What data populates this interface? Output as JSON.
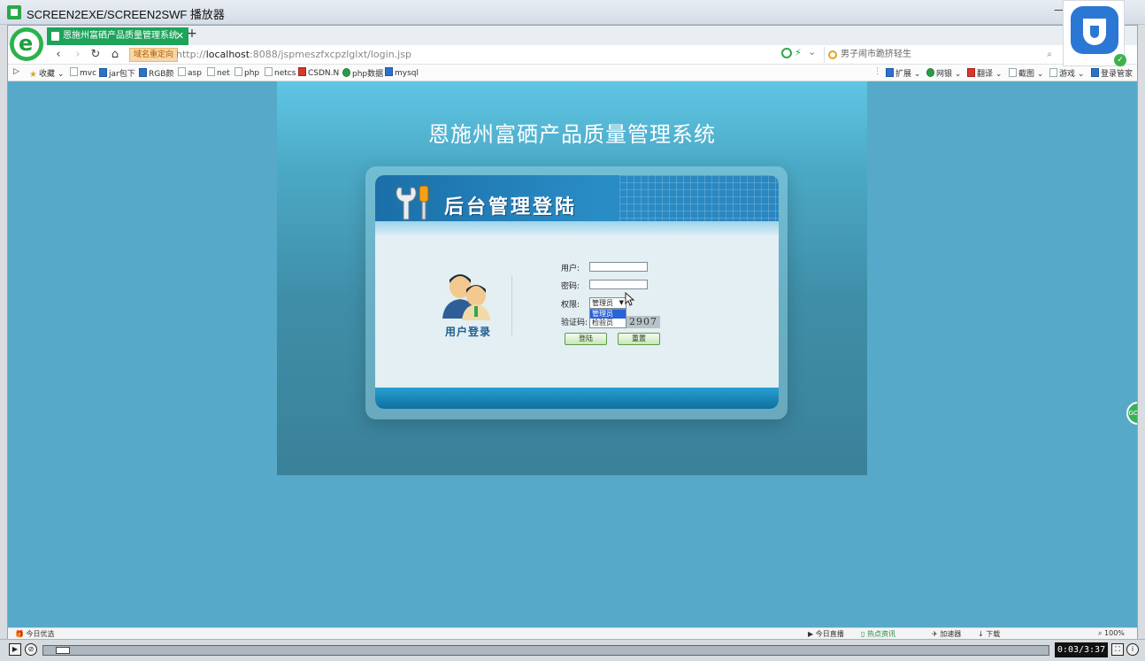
{
  "window": {
    "title": "SCREEN2EXE/SCREEN2SWF 播放器"
  },
  "browser": {
    "tab_title": "恩施州富硒产品质量管理系统",
    "new_tab": "+",
    "redirect_badge": "域名重定向",
    "url_host": "localhost",
    "url_prefix": "http://",
    "url_rest": ":8088/jspmeszfxcpzlglxt/login.jsp",
    "search_text": "男子闹市跪挤轻生",
    "bookmarks": [
      "收藏",
      "mvc",
      "jar包下",
      "RGB颜",
      "asp",
      "net",
      "php",
      "netcs",
      "CSDN.N",
      "php数据",
      "mysql"
    ],
    "toolbar_right": [
      "扩展",
      "网银",
      "翻译",
      "截图",
      "游戏",
      "登录管家"
    ]
  },
  "page": {
    "system_title": "恩施州富硒产品质量管理系统",
    "header_text": "后台管理登陆",
    "users_label": "用户登录",
    "username_label": "用户:",
    "password_label": "密码:",
    "role_label": "权限:",
    "captcha_label": "验证码:",
    "role_selected": "管理员",
    "role_options": [
      "管理员",
      "检验员"
    ],
    "captcha_value": "2907",
    "login_button": "登陆",
    "reset_button": "重置",
    "side_handle": "GO"
  },
  "statusbar": {
    "left": "今日优选",
    "items": [
      "今日直播",
      "热点资讯",
      "加速器",
      "下载"
    ],
    "zoom": "100%"
  },
  "player": {
    "time": "0:03/3:37"
  },
  "colors": {
    "page_bg": "#56a9c8",
    "tab_green": "#1da35a",
    "header_blue": "#1b6fa8",
    "button_green": "#c8e6b7"
  }
}
